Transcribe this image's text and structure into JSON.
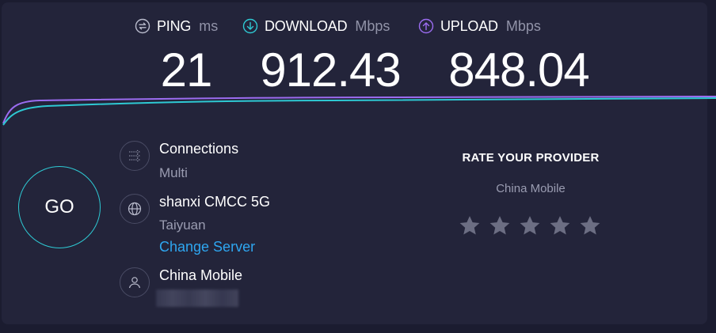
{
  "metrics": {
    "ping": {
      "label": "PING",
      "unit": "ms",
      "value": "21",
      "icon": "ping-icon"
    },
    "download": {
      "label": "DOWNLOAD",
      "unit": "Mbps",
      "value": "912.43",
      "icon": "download-arrow-icon"
    },
    "upload": {
      "label": "UPLOAD",
      "unit": "Mbps",
      "value": "848.04",
      "icon": "upload-arrow-icon"
    }
  },
  "colors": {
    "download": "#2ec9d3",
    "upload": "#9b6cf0",
    "link": "#2ea6f0",
    "background": "#23243a"
  },
  "go_button": {
    "label": "GO"
  },
  "connections": {
    "title": "Connections",
    "value": "Multi",
    "icon": "connections-icon"
  },
  "server": {
    "title": "shanxi CMCC 5G",
    "location": "Taiyuan",
    "change_label": "Change Server",
    "icon": "globe-icon"
  },
  "provider": {
    "title": "China Mobile",
    "icon": "user-icon"
  },
  "rating": {
    "title": "RATE YOUR PROVIDER",
    "provider": "China Mobile",
    "stars_total": 5,
    "stars_selected": 0
  }
}
